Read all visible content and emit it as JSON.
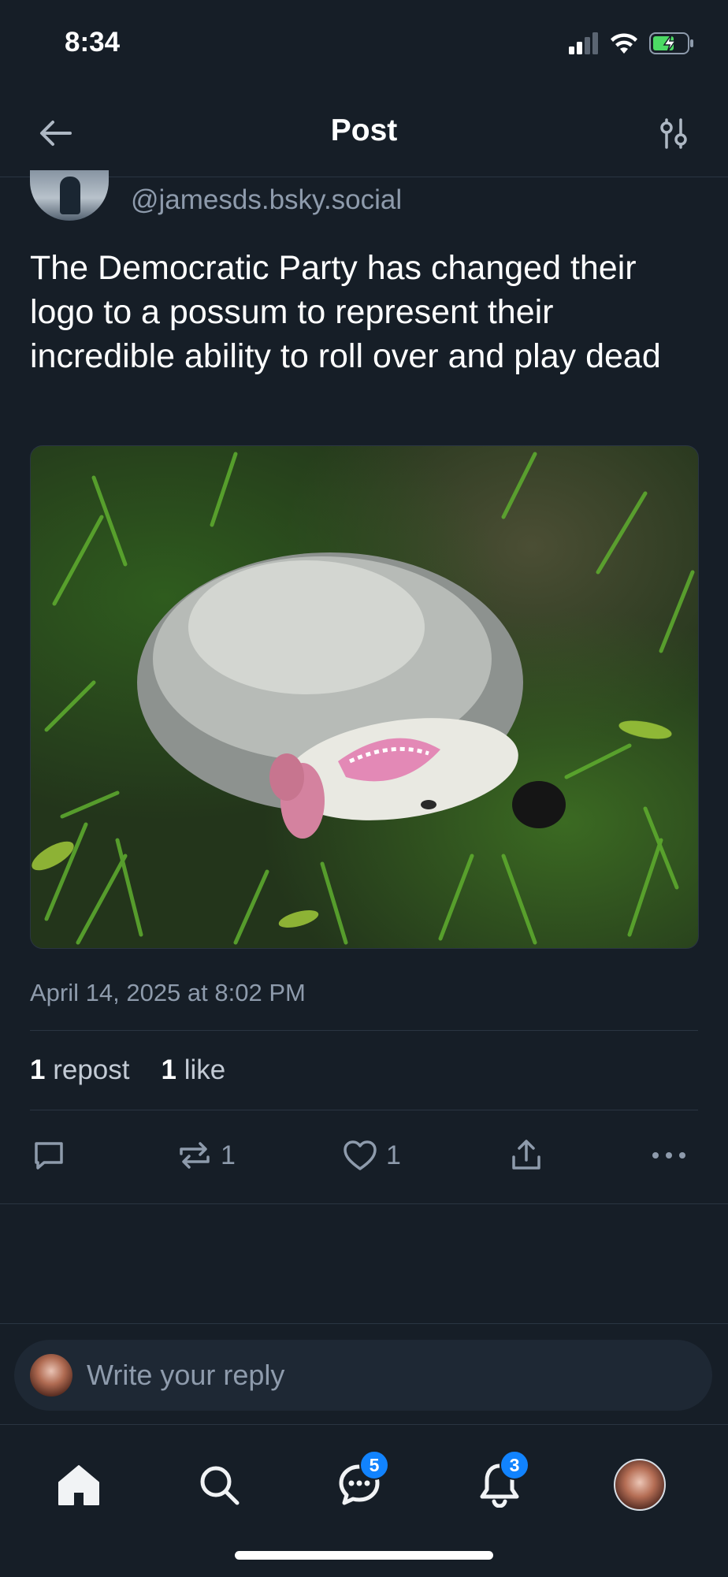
{
  "status_bar": {
    "time": "8:34"
  },
  "header": {
    "title": "Post"
  },
  "post": {
    "handle": "@jamesds.bsky.social",
    "text": "The Democratic Party has changed their logo to a possum to represent their incredible ability to roll over and play dead",
    "image_alt": "Opossum playing dead in the grass",
    "timestamp": "April 14, 2025 at 8:02 PM",
    "stats": {
      "reposts_count": "1",
      "reposts_label": "repost",
      "likes_count": "1",
      "likes_label": "like"
    },
    "actions": {
      "repost_count": "1",
      "like_count": "1"
    }
  },
  "reply": {
    "placeholder": "Write your reply"
  },
  "tabbar": {
    "chat_badge": "5",
    "notifications_badge": "3"
  },
  "colors": {
    "background": "#161e27",
    "accent": "#1183fe",
    "muted_text": "#8e9bac"
  }
}
